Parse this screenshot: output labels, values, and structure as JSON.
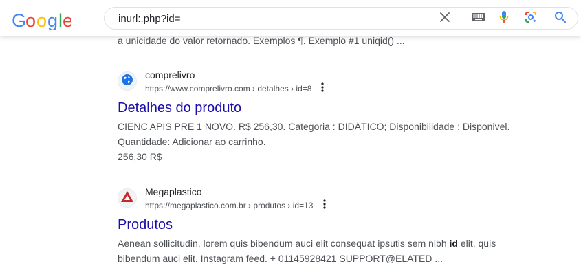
{
  "header": {
    "logo_text": "Google",
    "search": {
      "value": "inurl:.php?id="
    },
    "icons": [
      "clear-icon",
      "keyboard-icon",
      "microphone-icon",
      "lens-icon",
      "search-icon"
    ]
  },
  "results": {
    "prev_snippet": "a unicidade do valor retornado. Exemplos ¶. Exemplo #1 uniqid() ...",
    "items": [
      {
        "site_name": "comprelivro",
        "url": "https://www.comprelivro.com › detalhes › id=8",
        "title": "Detalhes do produto",
        "desc_line1": "CIENC APIS PRE 1 NOVO. R$ 256,30. Categoria : DIDÁTICO; Disponibilidade : Disponivel.",
        "desc_line2": "Quantidade: Adicionar ao carrinho.",
        "price": "256,30 R$",
        "favicon": "globe-icon"
      },
      {
        "site_name": "Megaplastico",
        "url": "https://megaplastico.com.br › produtos › id=13",
        "title": "Produtos",
        "desc_line1_a": "Aenean sollicitudin, lorem quis bibendum auci elit consequat ipsutis sem nibh ",
        "desc_line1_bold": "id",
        "desc_line1_b": " elit. quis",
        "desc_line2": "bibendum auci elit. Instagram feed. + 01145928421 SUPPORT@ELATED ...",
        "favicon": "megaplastico-logo-icon"
      }
    ]
  },
  "colors": {
    "link": "#1a0dab",
    "text": "#4d5156",
    "google_blue": "#4285f4",
    "google_red": "#ea4335",
    "google_yellow": "#fbbc05",
    "google_green": "#34a853"
  }
}
